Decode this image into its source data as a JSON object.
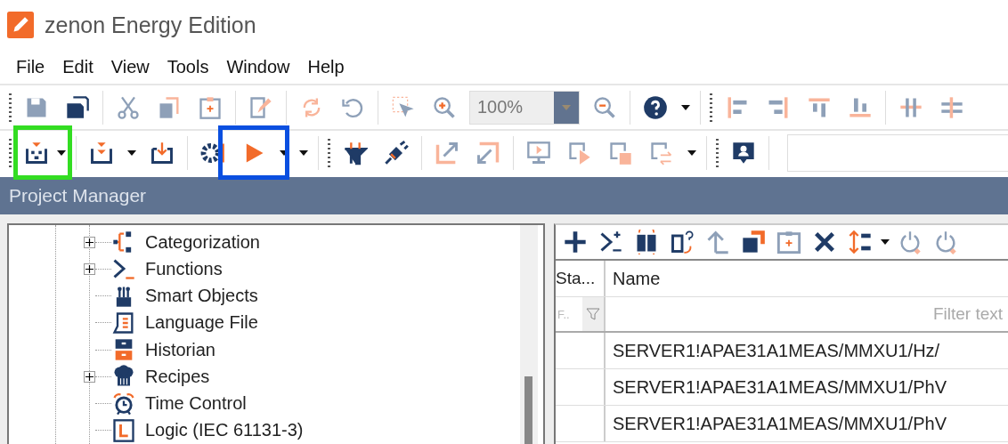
{
  "window": {
    "title": "zenon Energy Edition"
  },
  "menu": [
    "File",
    "Edit",
    "View",
    "Tools",
    "Window",
    "Help"
  ],
  "toolbar": {
    "zoom": "100%"
  },
  "highlights": [
    {
      "color": "#33dd22"
    },
    {
      "color": "#0a4fe0"
    }
  ],
  "panel": {
    "title": "Project Manager"
  },
  "tree": [
    {
      "label": "Categorization",
      "kind": "categorization",
      "expandable": true
    },
    {
      "label": "Functions",
      "kind": "functions",
      "expandable": true
    },
    {
      "label": "Smart Objects",
      "kind": "smart-objects",
      "expandable": false
    },
    {
      "label": "Language File",
      "kind": "language-file",
      "expandable": false
    },
    {
      "label": "Historian",
      "kind": "historian",
      "expandable": false
    },
    {
      "label": "Recipes",
      "kind": "recipes",
      "expandable": true
    },
    {
      "label": "Time Control",
      "kind": "time-control",
      "expandable": false
    },
    {
      "label": "Logic (IEC 61131-3)",
      "kind": "logic",
      "expandable": false
    }
  ],
  "table": {
    "columns": [
      "Sta...",
      "Name"
    ],
    "filter": {
      "status": "F..",
      "placeholder": "Filter text"
    },
    "rows": [
      {
        "name": "SERVER1!APAE31A1MEAS/MMXU1/Hz/"
      },
      {
        "name": "SERVER1!APAE31A1MEAS/MMXU1/PhV"
      },
      {
        "name": "SERVER1!APAE31A1MEAS/MMXU1/PhV"
      }
    ]
  }
}
